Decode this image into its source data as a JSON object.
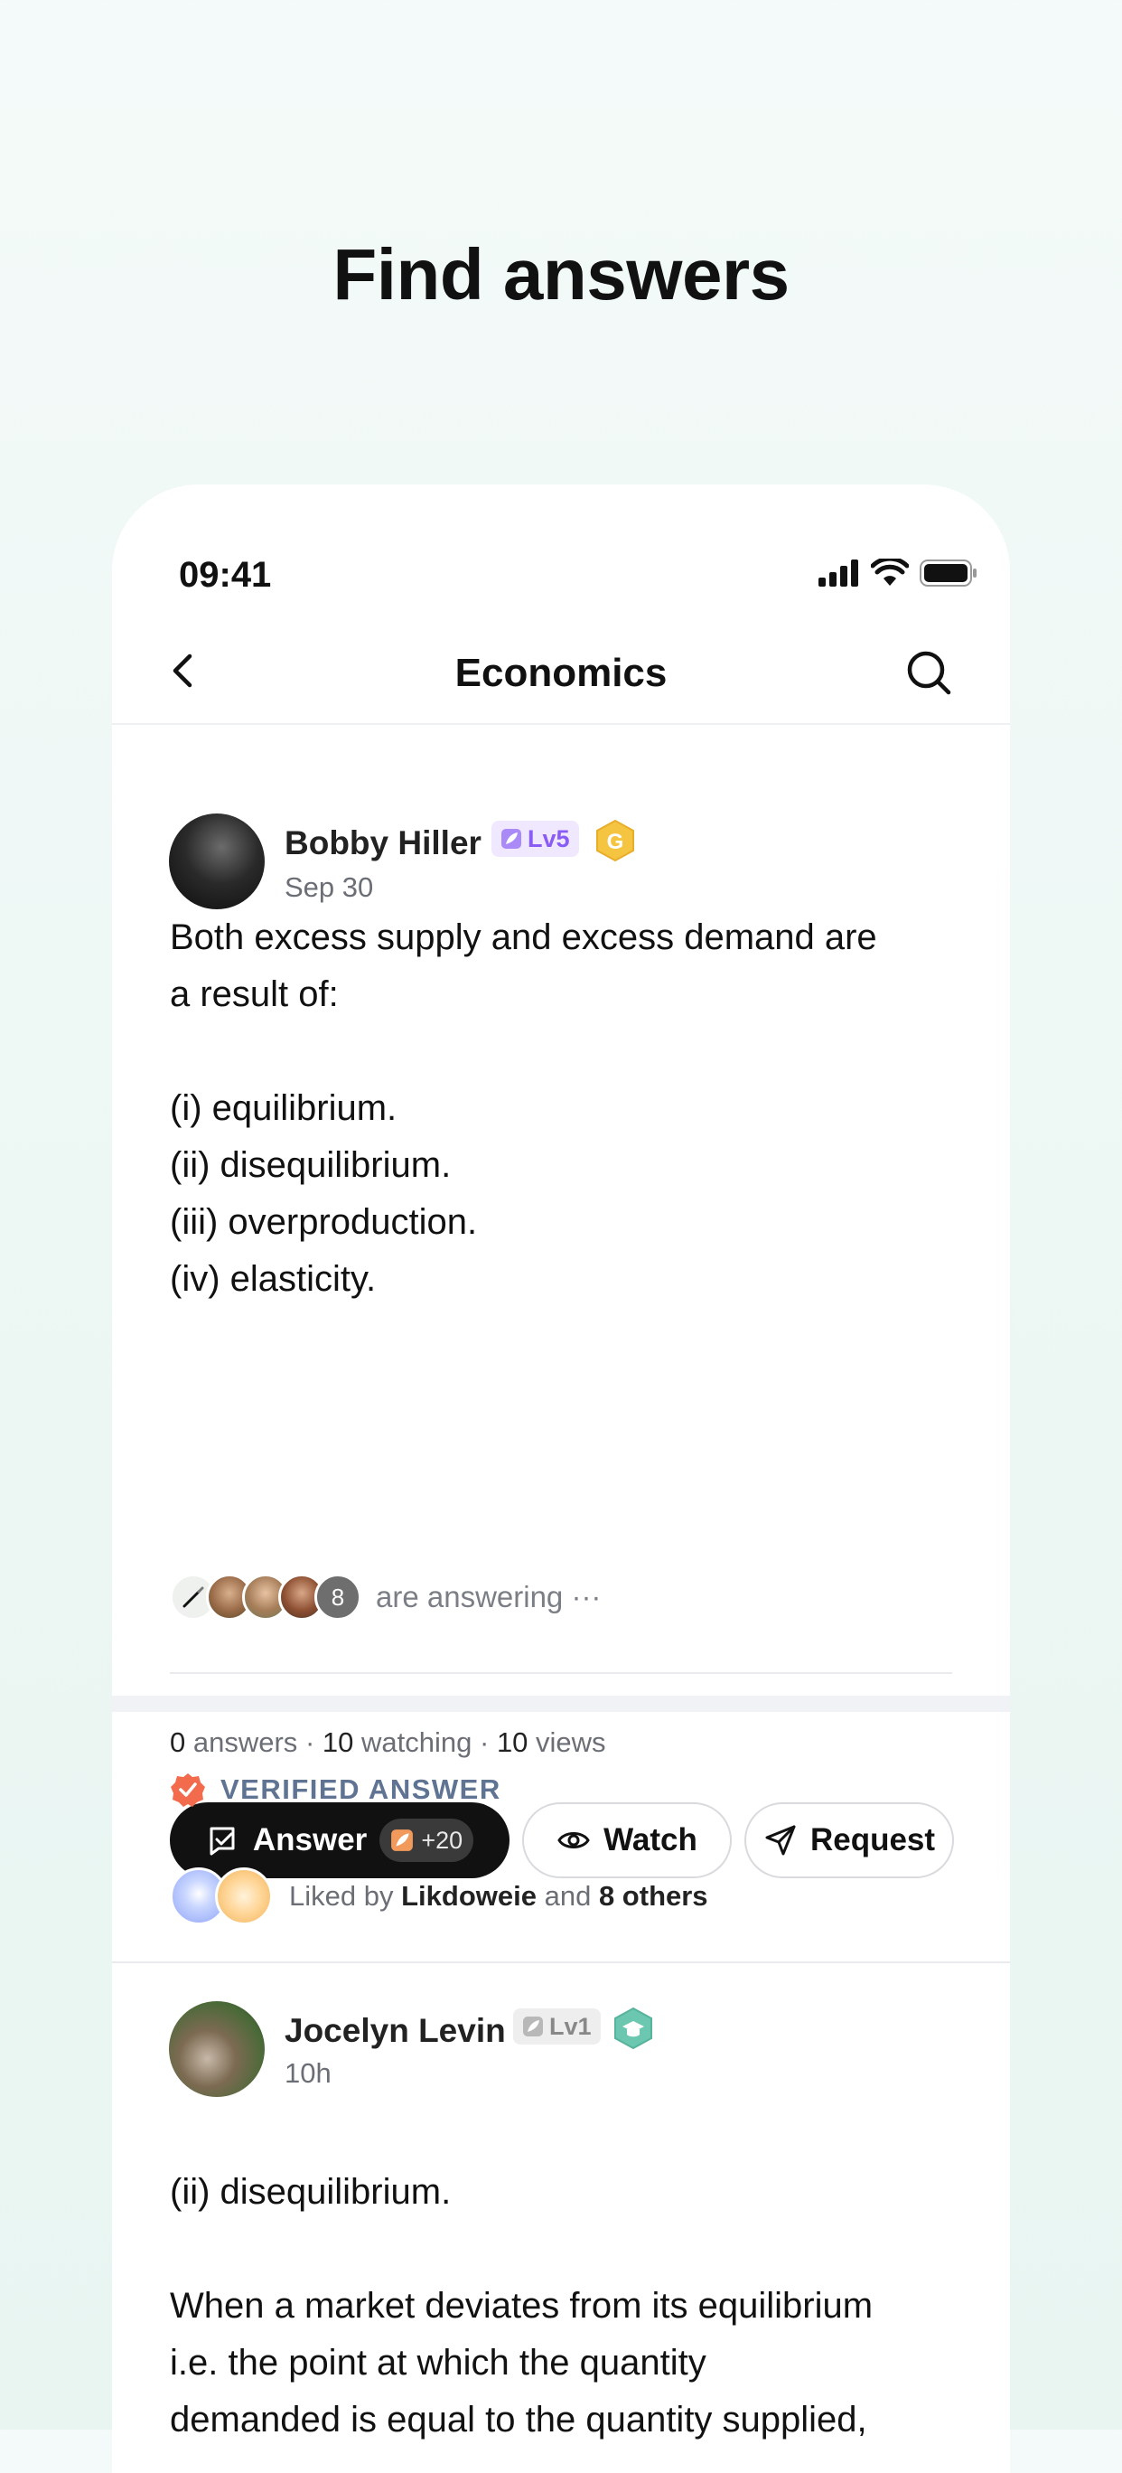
{
  "headline": "Find answers",
  "status_bar": {
    "time": "09:41"
  },
  "nav": {
    "title": "Economics"
  },
  "question": {
    "author": "Bobby Hiller",
    "level": "Lv5",
    "rank_badge": "G",
    "date": "Sep 30",
    "text_lines": [
      "Both excess supply and excess demand are",
      "a result of:",
      "",
      "(i) equilibrium.",
      "(ii) disequilibrium.",
      "(iii) overproduction.",
      "(iv) elasticity."
    ],
    "answering_count": "8",
    "answering_text": "are answering ···",
    "stats": {
      "answers_num": "0",
      "answers_label": "answers",
      "watching_num": "10",
      "watching_label": "watching",
      "views_num": "10",
      "views_label": "views",
      "separator": "·"
    },
    "buttons": {
      "answer": "Answer",
      "answer_points": "+20",
      "watch": "Watch",
      "request": "Request"
    }
  },
  "verified": {
    "label": "VERIFIED ANSWER",
    "liked_prefix": "Liked by",
    "liked_user": "Likdoweie",
    "liked_and": "and",
    "liked_others": "8 others"
  },
  "answer": {
    "author": "Jocelyn Levin",
    "level": "Lv1",
    "time": "10h",
    "text_lines": [
      "(ii) disequilibrium.",
      "",
      "When a market deviates from its equilibrium",
      "i.e. the point at which the quantity",
      "demanded is equal to the quantity supplied,"
    ]
  },
  "colors": {
    "accent_purple": "#8a5cf5",
    "level_bg_purple": "#efe8ff",
    "gold_badge": "#f5c542",
    "verified_orange": "#f26b4c",
    "verified_text": "#5f7393",
    "teal_badge": "#6cc7b0"
  },
  "icons": [
    "back-chevron-icon",
    "search-icon",
    "signal-icon",
    "wifi-icon",
    "battery-icon",
    "leaf-icon",
    "answer-icon",
    "eye-icon",
    "send-icon",
    "verified-badge-icon"
  ]
}
